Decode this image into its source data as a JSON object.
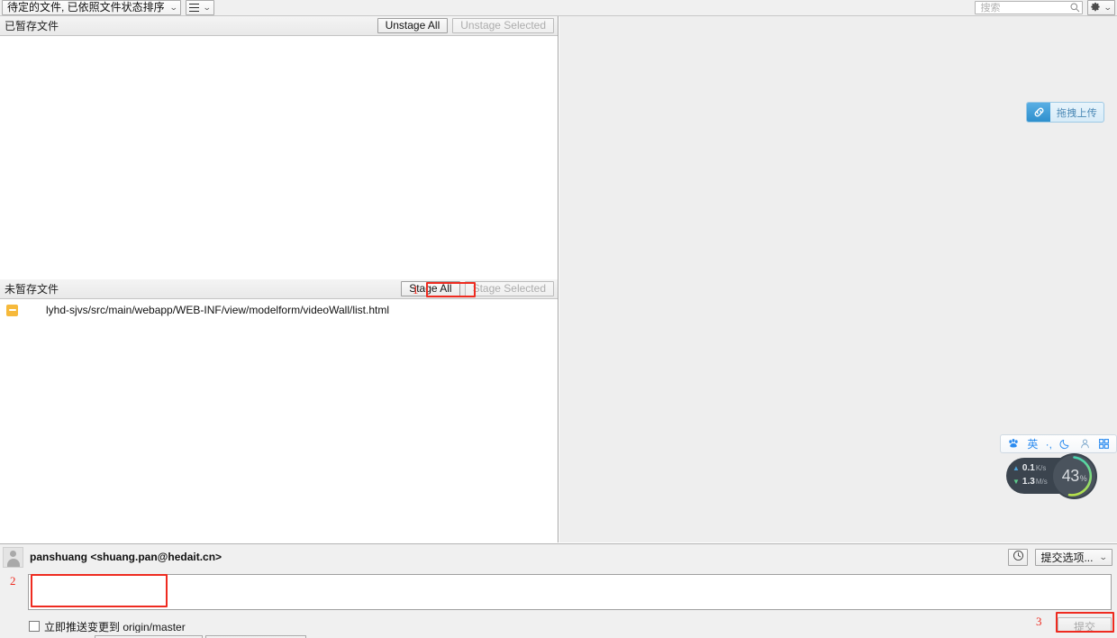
{
  "toolbar": {
    "sort_combo_label": "待定的文件, 已依照文件状态排序",
    "caret": "⌄",
    "menu_caret": "⌄",
    "search_placeholder": "搜索",
    "search_value": "",
    "gear_caret": "⌄"
  },
  "staged": {
    "title": "已暂存文件",
    "unstage_all_label": "Unstage All",
    "unstage_selected_label": "Unstage Selected",
    "files": []
  },
  "unstaged": {
    "title": "未暂存文件",
    "stage_all_label": "Stage All",
    "stage_selected_label": "Stage Selected",
    "files": [
      {
        "path": "lyhd-sjvs/src/main/webapp/WEB-INF/view/modelform/videoWall/list.html",
        "status": "modified"
      }
    ]
  },
  "upload_widget": {
    "label": "拖拽上传"
  },
  "ime_bar": {
    "items": [
      "paw-logo-icon",
      "英",
      "·,",
      "moon-icon",
      "user-icon",
      "grid-icon"
    ],
    "mode_label": "英",
    "punctuation_label": "·,"
  },
  "net_widget": {
    "upload_value": "0.1",
    "upload_unit": "K/s",
    "download_value": "1.3",
    "download_unit": "M/s",
    "gauge_value": "43",
    "gauge_unit": "%",
    "gauge_percent": 43
  },
  "commit": {
    "author": "panshuang <shuang.pan@hedait.cn>",
    "history_icon": "clock-icon",
    "options_label": "提交选项...",
    "options_caret": "⌄",
    "message_value": "",
    "message_placeholder": "",
    "push_checkbox_label": "立即推送变更到 origin/master",
    "push_checked": false,
    "commit_button_label": "提交",
    "commit_button_disabled": true
  },
  "annotations": [
    {
      "number": "1",
      "target": "stage-all-button"
    },
    {
      "number": "2",
      "target": "commit-message-input"
    },
    {
      "number": "3",
      "target": "commit-button"
    }
  ],
  "colors": {
    "annotation_red": "#ee2b20",
    "modified_file_icon": "#f6b93b",
    "ime_blue": "#2d8cf0",
    "upload_blue": "#2e8fcd"
  }
}
